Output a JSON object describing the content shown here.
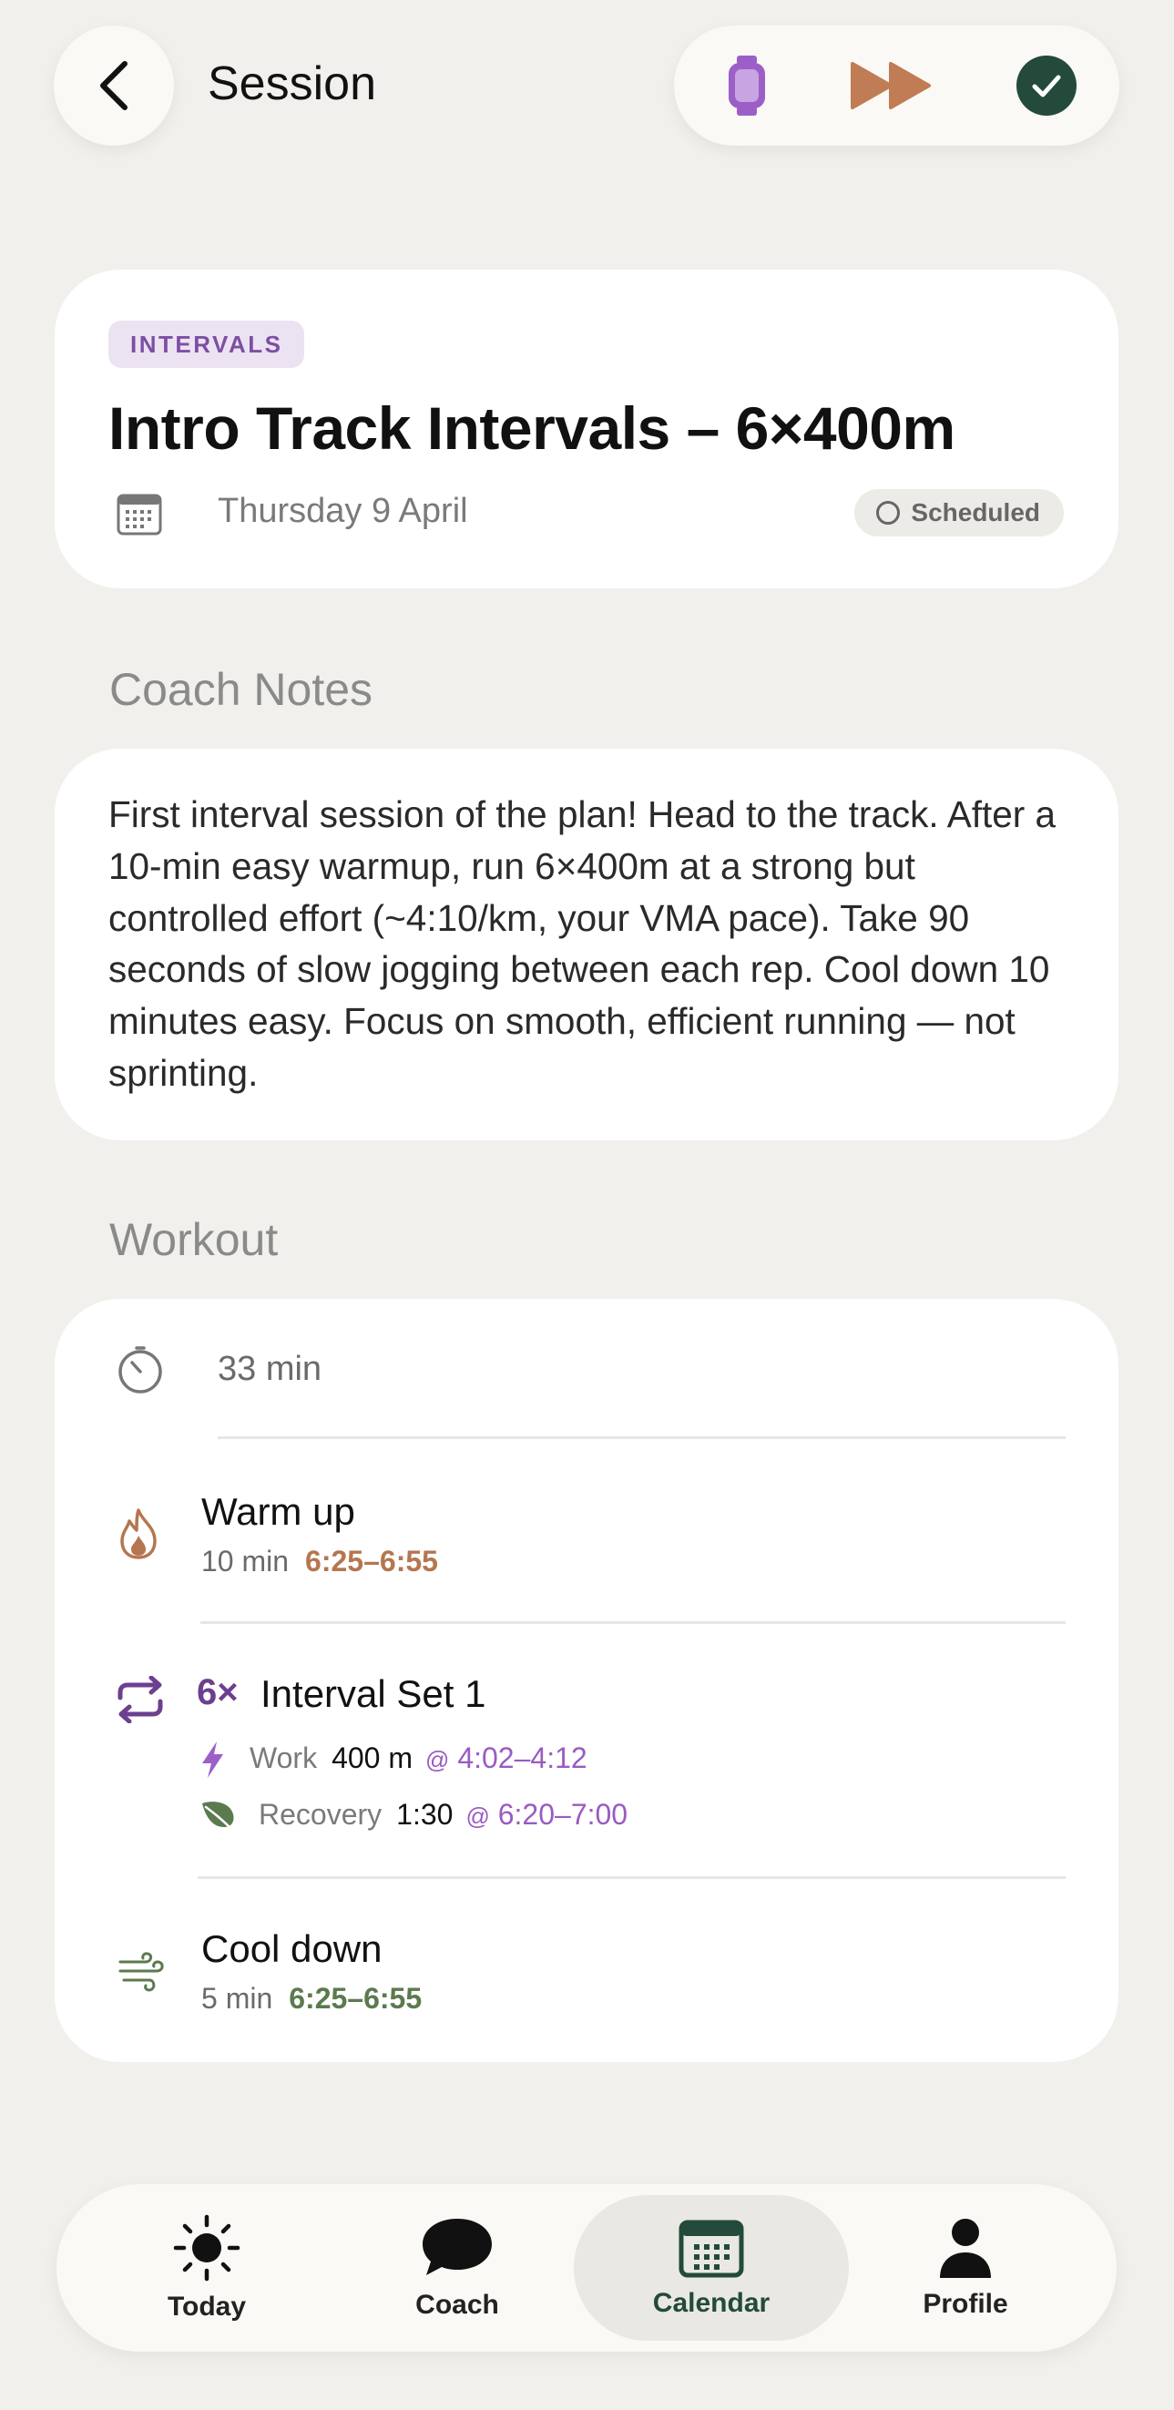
{
  "header": {
    "title": "Session"
  },
  "session": {
    "type_badge": "INTERVALS",
    "title": "Intro Track Intervals – 6×400m",
    "date": "Thursday 9 April",
    "status": "Scheduled"
  },
  "notes": {
    "heading": "Coach Notes",
    "text": "First interval session of the plan! Head to the track. After a 10-min easy warmup, run 6×400m at a strong but controlled effort (~4:10/km, your VMA pace). Take 90 seconds of slow jogging between each rep. Cool down 10 minutes easy. Focus on smooth, efficient running — not sprinting."
  },
  "workout": {
    "heading": "Workout",
    "total_duration": "33 min",
    "warmup": {
      "name": "Warm up",
      "duration": "10 min",
      "pace": "6:25–6:55"
    },
    "interval_set": {
      "reps": "6×",
      "name": "Interval Set 1",
      "work_label": "Work",
      "work_value": "400 m",
      "work_at": "@",
      "work_pace": "4:02–4:12",
      "recovery_label": "Recovery",
      "recovery_value": "1:30",
      "recovery_at": "@",
      "recovery_pace": "6:20–7:00"
    },
    "cooldown": {
      "name": "Cool down",
      "duration": "5 min",
      "pace": "6:25–6:55"
    }
  },
  "nav": {
    "items": [
      {
        "label": "Today",
        "icon": "sun-icon"
      },
      {
        "label": "Coach",
        "icon": "chat-bubble-icon"
      },
      {
        "label": "Calendar",
        "icon": "calendar-icon",
        "active": true
      },
      {
        "label": "Profile",
        "icon": "person-icon"
      }
    ]
  },
  "colors": {
    "background": "#f1f0ec",
    "card": "#ffffff",
    "accent_purple": "#7d4fa3",
    "accent_orange": "#b5764f",
    "accent_green": "#5b7a4e",
    "nav_active": "#234a3b"
  }
}
